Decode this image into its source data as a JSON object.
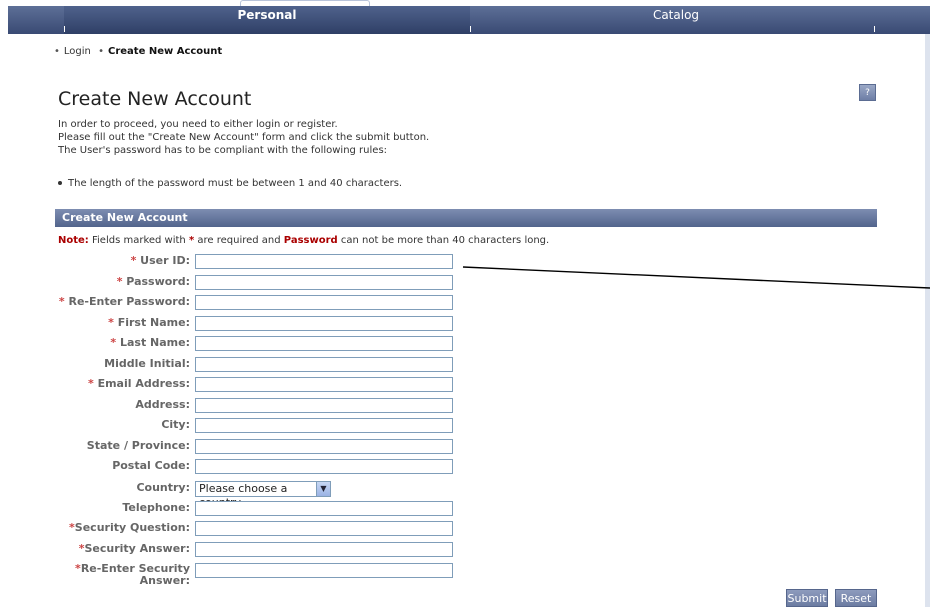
{
  "tabs": {
    "personal": "Personal",
    "catalog": "Catalog"
  },
  "breadcrumb": {
    "login": "Login",
    "current": "Create New Account"
  },
  "help_icon": "?",
  "title": "Create New Account",
  "intro": [
    "In order to proceed, you need to either login or register.",
    "Please fill out the \"Create New Account\" form and click the submit button.",
    "The User's password has to be compliant with the following rules:"
  ],
  "rule": "The length of the password must be between 1 and 40 characters.",
  "section_title": "Create New Account",
  "note": {
    "label": "Note:",
    "text1": " Fields marked with ",
    "star": "*",
    "text2": " are required and ",
    "bold": "Password",
    "text3": " can not be more than 40 characters long."
  },
  "fields": {
    "user_id": {
      "star": "* ",
      "label": "User ID:",
      "value": ""
    },
    "password": {
      "star": "* ",
      "label": "Password:",
      "value": ""
    },
    "reenter_password": {
      "star": "* ",
      "label": "Re-Enter Password:",
      "value": ""
    },
    "first_name": {
      "star": "* ",
      "label": "First Name:",
      "value": ""
    },
    "last_name": {
      "star": "* ",
      "label": "Last Name:",
      "value": ""
    },
    "middle_initial": {
      "star": "",
      "label": "Middle Initial:",
      "value": ""
    },
    "email": {
      "star": "* ",
      "label": "Email Address:",
      "value": ""
    },
    "address": {
      "star": "",
      "label": "Address:",
      "value": ""
    },
    "city": {
      "star": "",
      "label": "City:",
      "value": ""
    },
    "state": {
      "star": "",
      "label": "State / Province:",
      "value": ""
    },
    "postal_code": {
      "star": "",
      "label": "Postal Code:",
      "value": ""
    },
    "country": {
      "star": "",
      "label": "Country:",
      "value": "Please choose a country"
    },
    "telephone": {
      "star": "",
      "label": "Telephone:",
      "value": ""
    },
    "security_question": {
      "star": "*",
      "label": "Security Question:",
      "value": ""
    },
    "security_answer": {
      "star": "*",
      "label": "Security Answer:",
      "value": ""
    },
    "reenter_security_answer": {
      "star": "*",
      "label": "Re-Enter Security",
      "label2": "Answer:",
      "value": ""
    }
  },
  "buttons": {
    "submit": "Submit",
    "reset": "Reset"
  },
  "colors": {
    "tab_bar": "#394a73",
    "section_bar": "#52648c",
    "required_star": "#cc4444",
    "note": "#aa0000"
  }
}
